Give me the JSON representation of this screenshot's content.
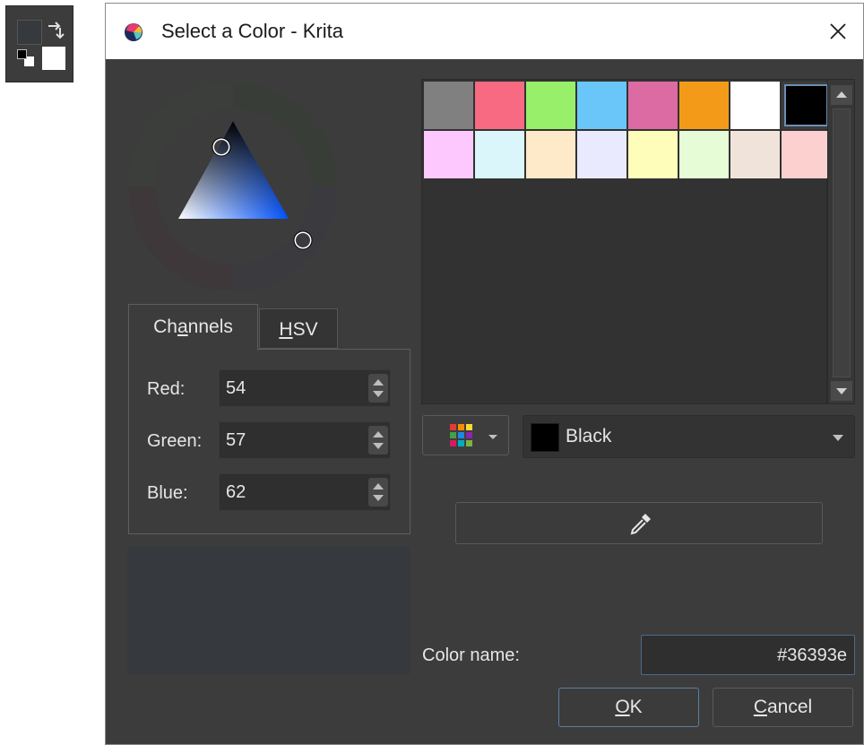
{
  "window": {
    "title": "Select a Color - Krita"
  },
  "tabs": [
    {
      "label_pre": "Ch",
      "label_ul": "a",
      "label_post": "nnels"
    },
    {
      "label_pre": "",
      "label_ul": "H",
      "label_post": "SV"
    }
  ],
  "channels": [
    {
      "label": "Red:",
      "value": "54"
    },
    {
      "label": "Green:",
      "value": "57"
    },
    {
      "label": "Blue:",
      "value": "62"
    }
  ],
  "current_color": "#36393e",
  "palette": {
    "swatches": [
      "#808080",
      "#f86a82",
      "#97ef6a",
      "#6ac6f8",
      "#dc6ba4",
      "#f39b19",
      "#ffffff",
      "#000000",
      "#fdc8fd",
      "#daf6fb",
      "#feeac8",
      "#e9eafe",
      "#fefdba",
      "#e5fcd6",
      "#f0e4da",
      "#fdd0d0"
    ],
    "selected_index": 7
  },
  "swatch_select": {
    "label": "Black",
    "color": "#000000"
  },
  "color_name": {
    "label": "Color name:",
    "value": "#36393e"
  },
  "buttons": {
    "ok_ul": "O",
    "ok_rest": "K",
    "cancel_ul": "C",
    "cancel_rest": "ancel"
  },
  "icons": [
    "krita-logo-icon",
    "close-icon",
    "palette-grid-icon",
    "eyedropper-icon",
    "swap-colors-icon"
  ]
}
